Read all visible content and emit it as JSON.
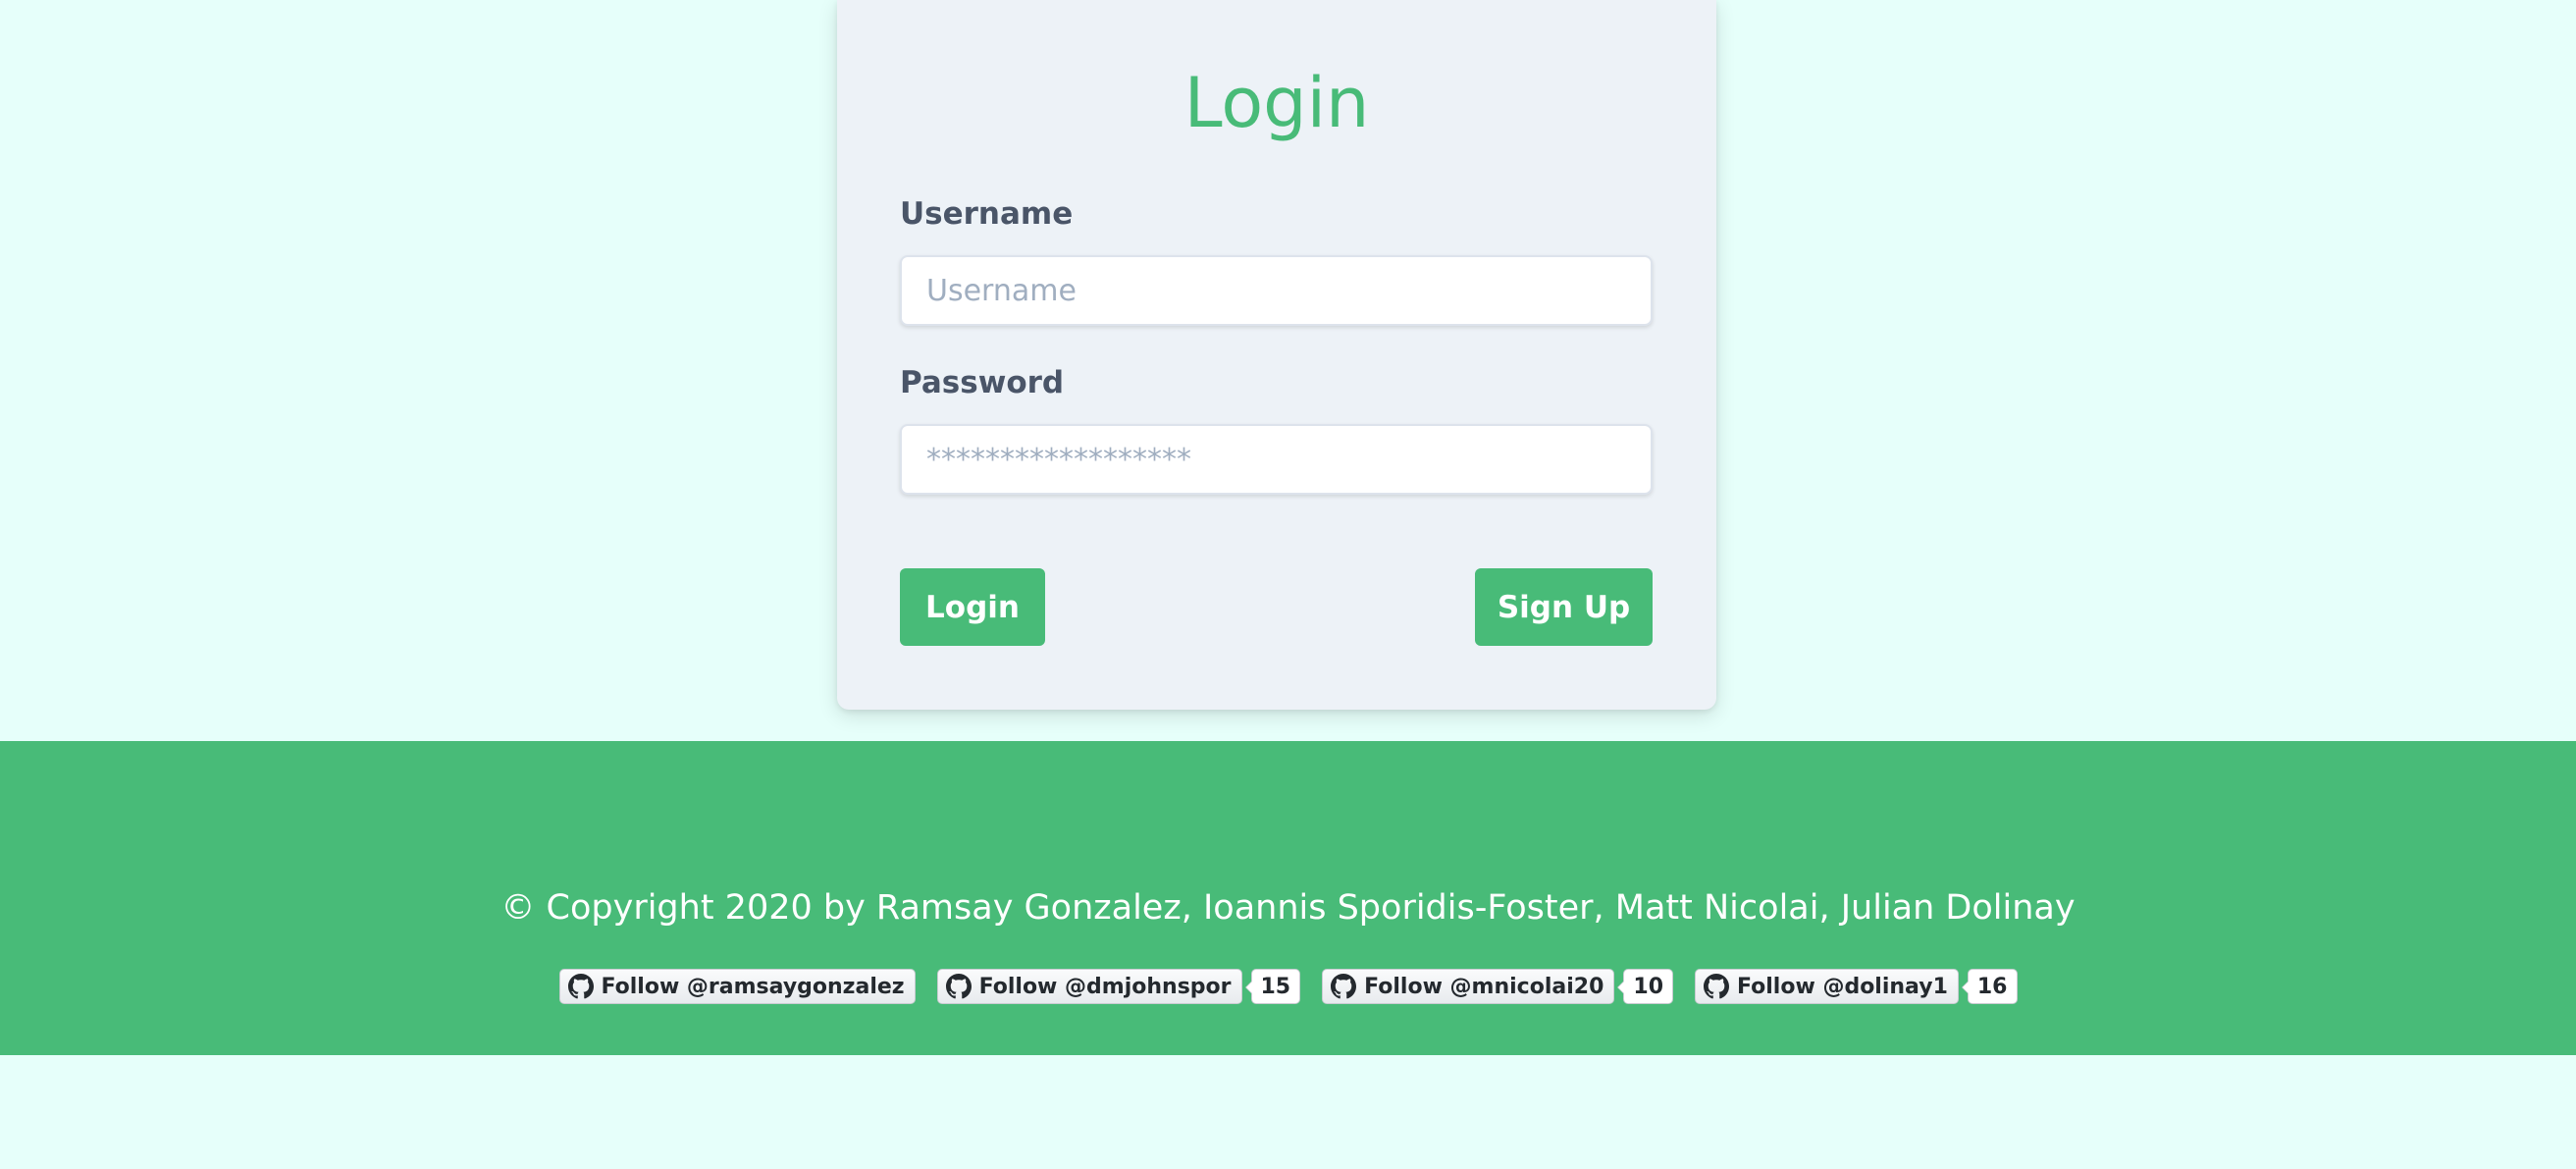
{
  "login_card": {
    "title": "Login",
    "username": {
      "label": "Username",
      "placeholder": "Username",
      "value": ""
    },
    "password": {
      "label": "Password",
      "placeholder": "******************",
      "value": ""
    },
    "login_button": "Login",
    "signup_button": "Sign Up"
  },
  "footer": {
    "copyright": "© Copyright 2020 by Ramsay Gonzalez, Ioannis Sporidis-Foster, Matt Nicolai, Julian Dolinay",
    "follow_buttons": [
      {
        "label": "Follow @ramsaygonzalez",
        "count": "",
        "icon": "github-icon"
      },
      {
        "label": "Follow @dmjohnspor",
        "count": "15",
        "icon": "github-icon"
      },
      {
        "label": "Follow @mnicolai20",
        "count": "10",
        "icon": "github-icon"
      },
      {
        "label": "Follow @dolinay1",
        "count": "16",
        "icon": "github-icon"
      }
    ]
  },
  "colors": {
    "background": "#e6fffa",
    "card": "#edf2f7",
    "accent": "#48bb78",
    "label_text": "#4a5568",
    "placeholder_text": "#a0aec0"
  }
}
